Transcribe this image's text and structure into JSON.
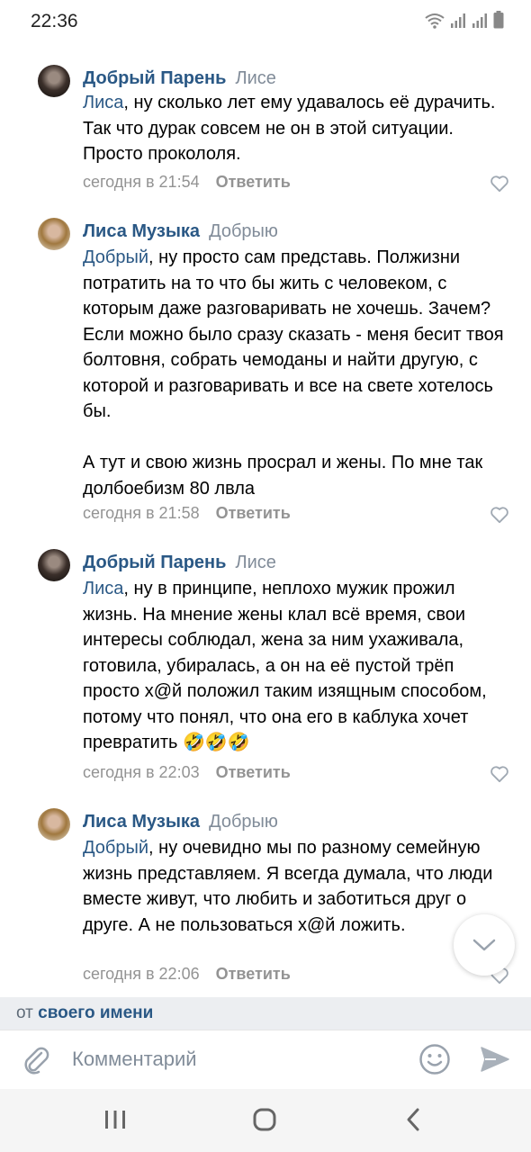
{
  "status": {
    "time": "22:36"
  },
  "comments": [
    {
      "author": "Добрый Парень",
      "reply_to": "Лисе",
      "mention": "Лиса",
      "text": ", ну сколько лет ему удавалось её дурачить. Так что дурак совсем не он в этой ситуации. Просто прокололя.",
      "time": "сегодня в 21:54",
      "reply_label": "Ответить"
    },
    {
      "author": "Лиса Музыка",
      "reply_to": "Добрыю",
      "mention": "Добрый",
      "text": ", ну просто сам представь. Полжизни потратить на то что бы жить с человеком, с которым даже разговаривать не хочешь. Зачем? Если можно было сразу сказать - меня бесит твоя болтовня, собрать чемоданы и найти другую, с которой и разговаривать и все на свете хотелось бы.",
      "text2": "А тут и свою жизнь просрал и жены. По мне так долбоебизм 80 лвла",
      "time": "сегодня в 21:58",
      "reply_label": "Ответить"
    },
    {
      "author": "Добрый Парень",
      "reply_to": "Лисе",
      "mention": "Лиса",
      "text": ", ну в принципе, неплохо мужик прожил жизнь. На мнение жены клал всё время, свои интересы соблюдал, жена за ним ухаживала, готовила, убиралась, а он на её пустой трёп просто х@й положил таким изящным способом, потому что понял, что она его в каблука хочет превратить 🤣🤣🤣",
      "time": "сегодня в 22:03",
      "reply_label": "Ответить"
    },
    {
      "author": "Лиса Музыка",
      "reply_to": "Добрыю",
      "mention": "Добрый",
      "text": ", ну очевидно мы по разному семейную жизнь представляем. Я всегда думала, что люди вместе живут, что любить и заботиться друг о друге. А не пользоваться х@й ложить.",
      "time": "сегодня в 22:06",
      "reply_label": "Ответить"
    }
  ],
  "from_bar": {
    "prefix": "от",
    "name": "своего имени"
  },
  "input": {
    "placeholder": "Комментарий"
  }
}
